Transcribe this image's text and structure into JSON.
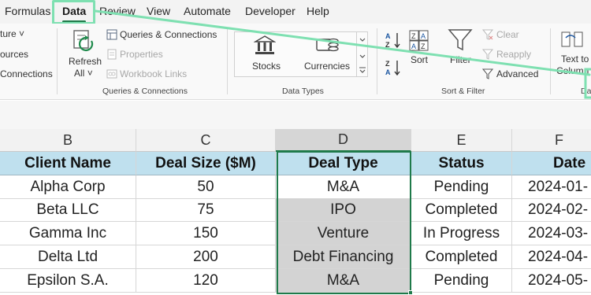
{
  "menu": {
    "items": [
      "Formulas",
      "Data",
      "Review",
      "View",
      "Automate",
      "Developer",
      "Help"
    ],
    "active": "Data"
  },
  "ribbon": {
    "get_data": {
      "sources_partial": "ture",
      "sources_arrow": "˅",
      "ources": "ources",
      "connections": "Connections"
    },
    "queries": {
      "refresh_label": "Refresh",
      "refresh_all": "All",
      "refresh_arrow": "˅",
      "queries_connections": "Queries & Connections",
      "properties": "Properties",
      "workbook_links": "Workbook Links",
      "group_label": "Queries & Connections"
    },
    "data_types": {
      "stocks": "Stocks",
      "currencies": "Currencies",
      "group_label": "Data Types"
    },
    "sort_filter": {
      "sort": "Sort",
      "filter": "Filter",
      "clear": "Clear",
      "reapply": "Reapply",
      "advanced": "Advanced",
      "group_label": "Sort & Filter"
    },
    "data_tools": {
      "text_to": "Text to",
      "columns_partial": "Column",
      "group_label_partial": "Da"
    }
  },
  "sheet": {
    "columns": [
      "B",
      "C",
      "D",
      "E",
      "F"
    ],
    "selected_column": "D",
    "headers": [
      "Client Name",
      "Deal Size ($M)",
      "Deal Type",
      "Status",
      "Date"
    ],
    "rows": [
      [
        "Alpha Corp",
        "50",
        "M&A",
        "Pending",
        "2024-01-"
      ],
      [
        "Beta LLC",
        "75",
        "IPO",
        "Completed",
        "2024-02-"
      ],
      [
        "Gamma Inc",
        "150",
        "Venture",
        "In Progress",
        "2024-03-"
      ],
      [
        "Delta Ltd",
        "200",
        "Debt Financing",
        "Completed",
        "2024-04-"
      ],
      [
        "Epsilon S.A.",
        "120",
        "M&A",
        "Pending",
        "2024-05-"
      ]
    ]
  },
  "colors": {
    "accent_green": "#1f7a4a",
    "annotation": "#7ee0b1",
    "header_fill": "#bfe0ee",
    "selection_fill": "#d3d3d3"
  }
}
